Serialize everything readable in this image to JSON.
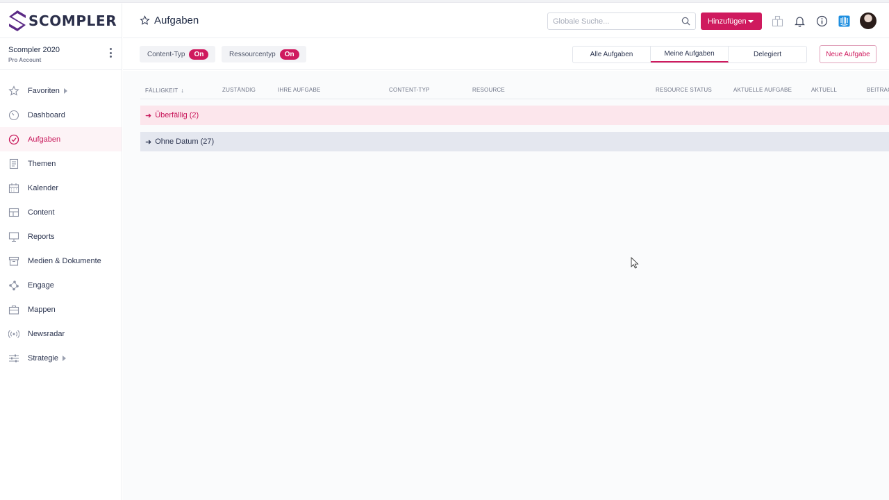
{
  "app": {
    "logo_text": "SCOMPLER",
    "brand_color": "#cf1a5e",
    "logo_color": "#5b2a86"
  },
  "account": {
    "name": "Scompler 2020",
    "plan": "Pro Account"
  },
  "sidebar": {
    "items": [
      {
        "label": "Favoriten",
        "icon": "star-icon",
        "has_submenu": true
      },
      {
        "label": "Dashboard",
        "icon": "gauge-icon"
      },
      {
        "label": "Aufgaben",
        "icon": "check-circle-icon",
        "active": true
      },
      {
        "label": "Themen",
        "icon": "document-icon"
      },
      {
        "label": "Kalender",
        "icon": "calendar-icon"
      },
      {
        "label": "Content",
        "icon": "grid-icon"
      },
      {
        "label": "Reports",
        "icon": "presentation-icon"
      },
      {
        "label": "Medien & Dokumente",
        "icon": "archive-icon"
      },
      {
        "label": "Engage",
        "icon": "network-icon"
      },
      {
        "label": "Mappen",
        "icon": "briefcase-icon"
      },
      {
        "label": "Newsradar",
        "icon": "radar-icon"
      },
      {
        "label": "Strategie",
        "icon": "sliders-icon",
        "has_submenu": true
      }
    ]
  },
  "header": {
    "title": "Aufgaben",
    "search_placeholder": "Globale Suche...",
    "add_label": "Hinzufügen"
  },
  "toolbar": {
    "filters": [
      {
        "label": "Content-Typ",
        "state": "On"
      },
      {
        "label": "Ressourcentyp",
        "state": "On"
      }
    ],
    "tabs": [
      {
        "label": "Alle Aufgaben"
      },
      {
        "label": "Meine Aufgaben",
        "active": true
      },
      {
        "label": "Delegiert"
      }
    ],
    "new_task_label": "Neue Aufgabe"
  },
  "table": {
    "columns": [
      "FÄLLIGKEIT",
      "ZUSTÄNDIG",
      "IHRE AUFGABE",
      "CONTENT-TYP",
      "RESOURCE",
      "RESOURCE STATUS",
      "AKTUELLE AUFGABE",
      "AKTUELL",
      "BEITRAG"
    ],
    "sort_arrow": "↓",
    "groups": [
      {
        "arrow": "➜",
        "label": "Überfällig (2)"
      },
      {
        "arrow": "➜",
        "label": "Ohne Datum (27)"
      }
    ]
  }
}
